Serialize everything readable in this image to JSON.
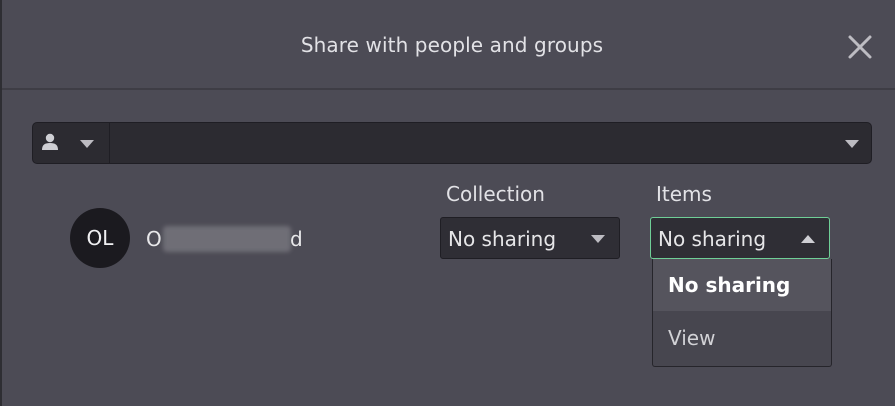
{
  "dialog": {
    "title": "Share with people and groups",
    "close_icon": "close-icon"
  },
  "picker": {
    "type_icon": "person-icon",
    "type_caret_icon": "chevron-down-icon",
    "input_value": "",
    "caret_icon": "chevron-down-icon"
  },
  "columns": {
    "collection": "Collection",
    "items": "Items"
  },
  "user": {
    "initials": "OL",
    "name_start": "O",
    "name_end": "d"
  },
  "collection_select": {
    "value": "No sharing",
    "caret_icon": "chevron-down-icon"
  },
  "items_select": {
    "value": "No sharing",
    "caret_icon": "chevron-up-icon",
    "focus_color": "#6fcf97",
    "options": [
      {
        "label": "No sharing",
        "selected": true
      },
      {
        "label": "View",
        "selected": false
      }
    ]
  }
}
